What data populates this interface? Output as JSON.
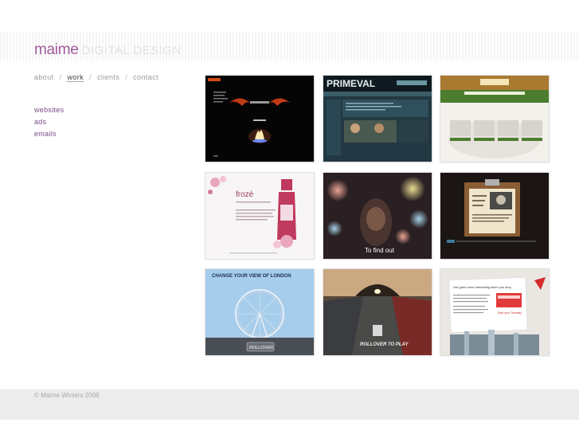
{
  "header": {
    "brand": "maime",
    "subtitle": "DIGITAL DESIGN"
  },
  "nav": {
    "items": [
      {
        "label": "about"
      },
      {
        "label": "work"
      },
      {
        "label": "clients"
      },
      {
        "label": "contact"
      }
    ],
    "separator": "/",
    "active_index": 1
  },
  "subnav": {
    "items": [
      {
        "label": "websites"
      },
      {
        "label": "ads"
      },
      {
        "label": "emails"
      }
    ]
  },
  "portfolio": {
    "tiles": [
      {
        "name": "dark-flame-site"
      },
      {
        "name": "primeval-site",
        "heading": "PRIMEVAL"
      },
      {
        "name": "travel-map-site"
      },
      {
        "name": "froze-wine-site",
        "heading": "frozé"
      },
      {
        "name": "to-find-out-ad",
        "caption": "To find out"
      },
      {
        "name": "clipboard-site"
      },
      {
        "name": "london-eye-ad",
        "heading": "CHANGE YOUR VIEW OF LONDON",
        "button": "ROLLOVER"
      },
      {
        "name": "tunnel-car-ad",
        "caption": "ROLLOVER TO PLAY"
      },
      {
        "name": "qantas-email",
        "heading": "Life goes more interesting when you stop",
        "cta": "Start your Thessaly"
      }
    ]
  },
  "footer": {
    "copyright": "© Maime Winters 2008"
  },
  "colors": {
    "brand": "#a15a9b",
    "link": "#7b4a86",
    "muted": "#9a9a9a"
  }
}
